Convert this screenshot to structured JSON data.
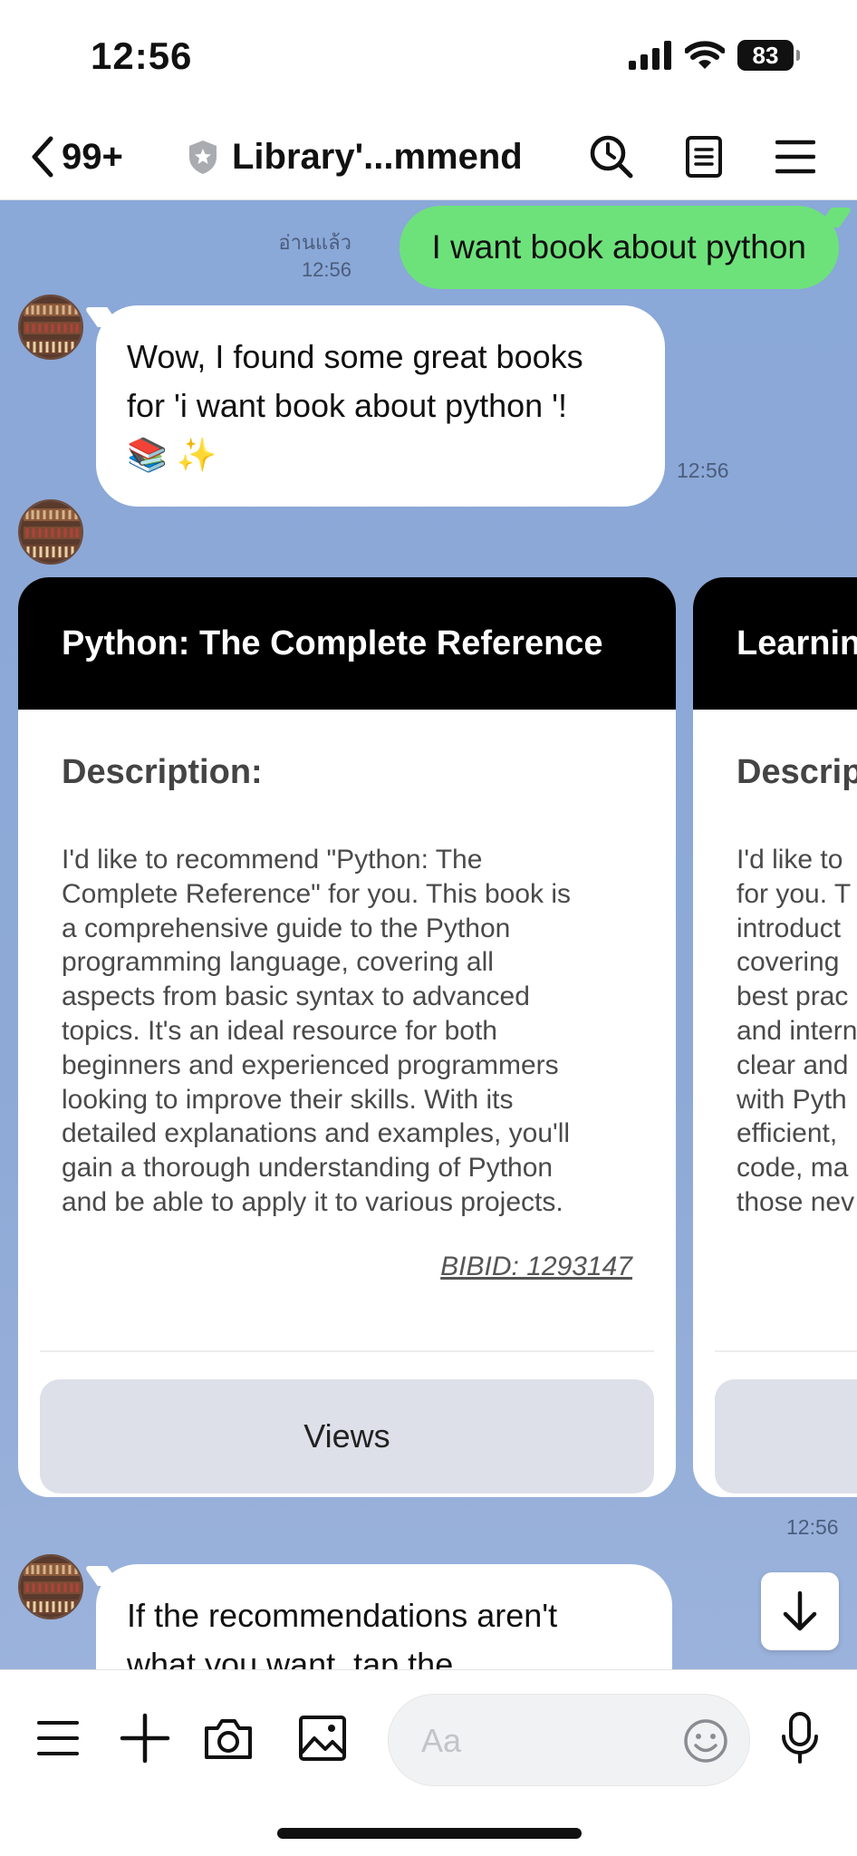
{
  "status_bar": {
    "time": "12:56",
    "battery": "83"
  },
  "header": {
    "back_count": "99+",
    "title": "Library'...mmend",
    "icons": [
      "chevron-left-icon",
      "shield-icon",
      "search-clock-icon",
      "notes-icon",
      "menu-icon"
    ]
  },
  "messages": {
    "outgoing": {
      "text": "I want book about python",
      "read_label": "อ่านแล้ว",
      "time": "12:56"
    },
    "incoming_1": {
      "line1": "Wow, I found some great books",
      "line2": "for 'i want book about python '!",
      "emoji": "📚 ✨",
      "time": "12:56"
    },
    "carousel_time": "12:56",
    "incoming_2": {
      "line1": "If the recommendations aren't",
      "line2": "what you want, tap the"
    }
  },
  "cards": [
    {
      "title": "Python: The Complete Reference",
      "description_label": "Description:",
      "description": "I'd like to recommend \"Python: The\nComplete Reference\" for you. This book is\na comprehensive guide to the Python\nprogramming language, covering all\naspects from basic syntax to advanced\ntopics. It's an ideal resource for both\nbeginners and experienced programmers\nlooking to improve their skills. With its\ndetailed explanations and examples, you'll\ngain a thorough understanding of Python\nand be able to apply it to various projects.",
      "bibid": "BIBID: 1293147",
      "button": "Views"
    },
    {
      "title": "Learnin",
      "description_label": "Descrip",
      "description": "I'd like to\nfor you. T\nintroduct\ncovering\nbest prac\nand intern\nclear and\nwith Pyth\nefficient,\ncode, ma\nthose nev",
      "button": ""
    }
  ],
  "input": {
    "placeholder": "Aa"
  },
  "colors": {
    "chat_bg": "#8aa8d8",
    "outgoing_bubble": "#6de27a",
    "card_header": "#000000",
    "button_bg": "#dde0e8"
  }
}
